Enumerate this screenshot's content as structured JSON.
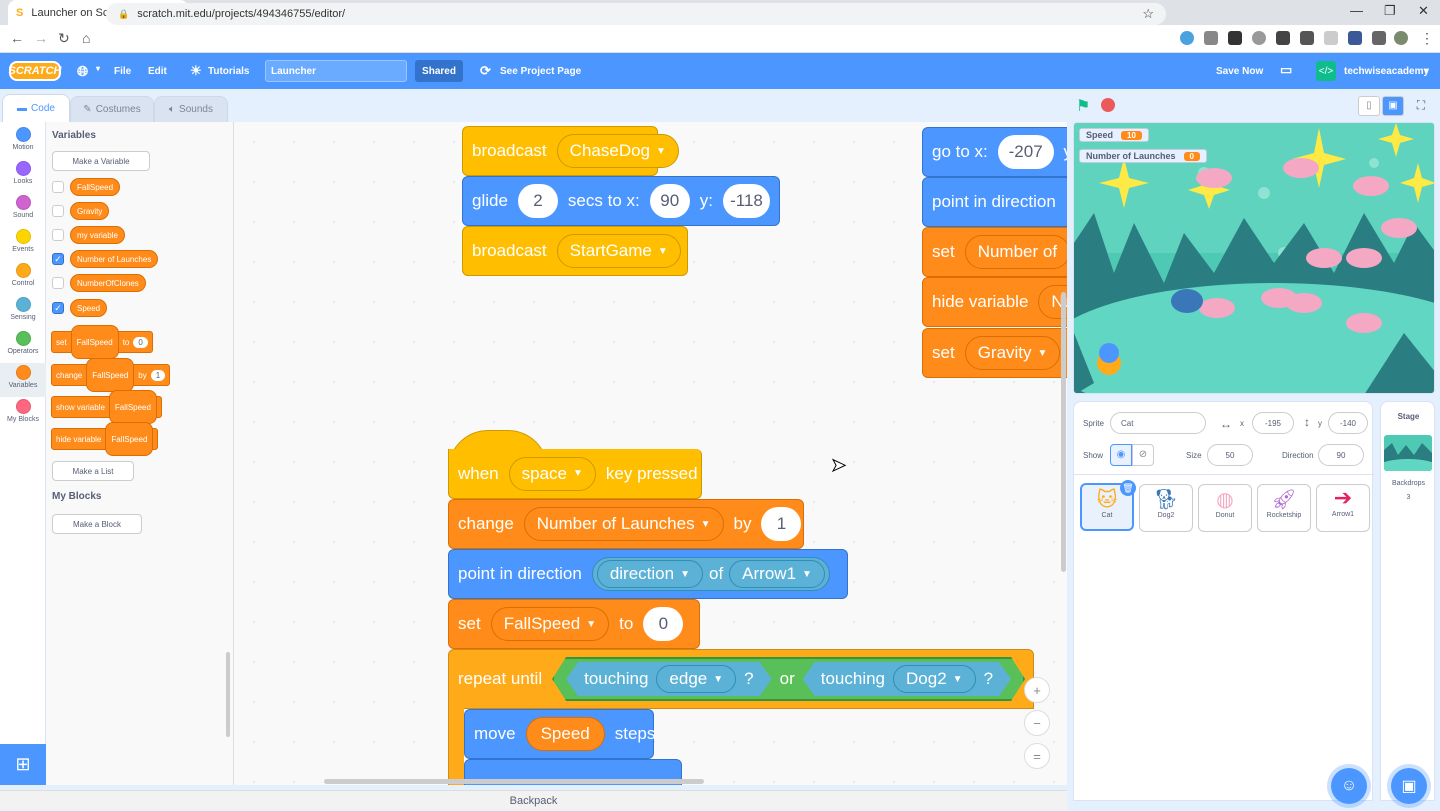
{
  "browser": {
    "tab_title": "Launcher on Scratch",
    "url": "scratch.mit.edu/projects/494346755/editor/"
  },
  "menubar": {
    "logo": "SCRATCH",
    "file": "File",
    "edit": "Edit",
    "tutorials": "Tutorials",
    "project_title": "Launcher",
    "shared": "Shared",
    "see_project": "See Project Page",
    "save_now": "Save Now",
    "username": "techwiseacademy"
  },
  "editor_tabs": {
    "code": "Code",
    "costumes": "Costumes",
    "sounds": "Sounds"
  },
  "categories": [
    {
      "label": "Motion",
      "color": "#4c97ff"
    },
    {
      "label": "Looks",
      "color": "#9966ff"
    },
    {
      "label": "Sound",
      "color": "#cf63cf"
    },
    {
      "label": "Events",
      "color": "#ffd500"
    },
    {
      "label": "Control",
      "color": "#ffab19"
    },
    {
      "label": "Sensing",
      "color": "#5cb1d6"
    },
    {
      "label": "Operators",
      "color": "#59c059"
    },
    {
      "label": "Variables",
      "color": "#ff8c1a"
    },
    {
      "label": "My Blocks",
      "color": "#ff6680"
    }
  ],
  "palette": {
    "variables_heading": "Variables",
    "make_variable": "Make a Variable",
    "variables": [
      {
        "name": "FallSpeed",
        "checked": false
      },
      {
        "name": "Gravity",
        "checked": false
      },
      {
        "name": "my variable",
        "checked": false
      },
      {
        "name": "Number of Launches",
        "checked": true
      },
      {
        "name": "NumberOfClones",
        "checked": false
      },
      {
        "name": "Speed",
        "checked": true
      }
    ],
    "set_block": {
      "word": "set",
      "var": "FallSpeed",
      "to": "to",
      "value": "0"
    },
    "change_block": {
      "word": "change",
      "var": "FallSpeed",
      "by": "by",
      "value": "1"
    },
    "show_block": {
      "word": "show variable",
      "var": "FallSpeed"
    },
    "hide_block": {
      "word": "hide variable",
      "var": "FallSpeed"
    },
    "make_list": "Make a List",
    "myblocks_heading": "My Blocks",
    "make_block": "Make a Block"
  },
  "script": {
    "top": {
      "broadcast1": {
        "word": "broadcast",
        "msg": "ChaseDog"
      },
      "glide": {
        "word": "glide",
        "secs": "2",
        "secs_label": "secs to x:",
        "x": "90",
        "y_label": "y:",
        "y": "-118"
      },
      "broadcast2": {
        "word": "broadcast",
        "msg": "StartGame"
      }
    },
    "right": {
      "goto": {
        "word": "go to x:",
        "x": "-207",
        "y_label": "y"
      },
      "point": "point in direction",
      "set1": {
        "word": "set",
        "var": "Number of"
      },
      "hide": {
        "word": "hide variable",
        "var": "Nu"
      },
      "set2": {
        "word": "set",
        "var": "Gravity"
      }
    },
    "main": {
      "when": {
        "word": "when",
        "key": "space",
        "rest": "key pressed"
      },
      "change": {
        "word": "change",
        "var": "Number of Launches",
        "by": "by",
        "value": "1"
      },
      "point": {
        "word": "point in direction",
        "dir": "direction",
        "of": "of",
        "obj": "Arrow1"
      },
      "set": {
        "word": "set",
        "var": "FallSpeed",
        "to": "to",
        "value": "0"
      },
      "repeat": {
        "word": "repeat until",
        "touching1": "touching",
        "obj1": "edge",
        "q1": "?",
        "or": "or",
        "touching2": "touching",
        "obj2": "Dog2",
        "q2": "?"
      },
      "move": {
        "word": "move",
        "var": "Speed",
        "rest": "steps"
      }
    }
  },
  "zoom": {
    "in": "+",
    "out": "−",
    "reset": "="
  },
  "backpack": "Backpack",
  "stage": {
    "monitors": [
      {
        "label": "Speed",
        "value": "10"
      },
      {
        "label": "Number of Launches",
        "value": "0"
      }
    ]
  },
  "sprite_info": {
    "sprite_label": "Sprite",
    "sprite_name": "Cat",
    "x_label": "x",
    "x": "-195",
    "y_label": "y",
    "y": "-140",
    "show_label": "Show",
    "size_label": "Size",
    "size": "50",
    "direction_label": "Direction",
    "direction": "90",
    "sprites": [
      "Cat",
      "Dog2",
      "Donut",
      "Rocketship",
      "Arrow1"
    ]
  },
  "stage_panel": {
    "label": "Stage",
    "backdrops_label": "Backdrops",
    "backdrops_count": "3"
  }
}
